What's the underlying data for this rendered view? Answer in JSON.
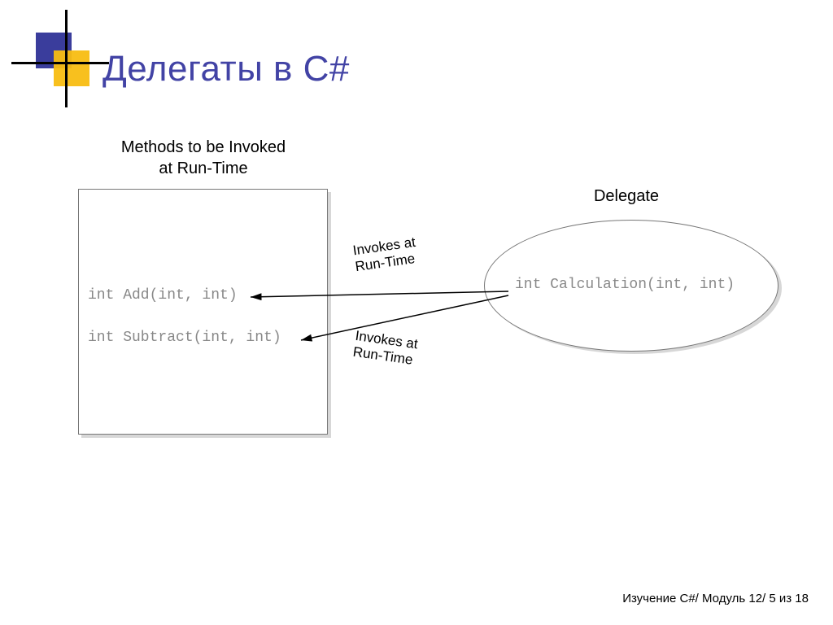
{
  "title": "Делегаты в C#",
  "diagram": {
    "methods_title_line1": "Methods to be Invoked",
    "methods_title_line2": "at Run-Time",
    "method_add": "int Add(int, int)",
    "method_sub": "int Subtract(int, int)",
    "delegate_title": "Delegate",
    "delegate_sig": "int Calculation(int, int)",
    "arrow_label_1a": "Invokes at",
    "arrow_label_1b": "Run-Time",
    "arrow_label_2a": "Invokes at",
    "arrow_label_2b": "Run-Time"
  },
  "footer": "Изучение C#/ Модуль 12/ 5 из 18"
}
